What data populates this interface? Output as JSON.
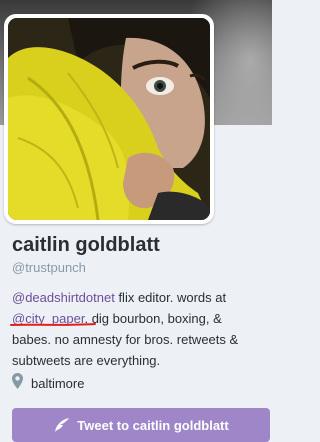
{
  "profile": {
    "display_name": "caitlin goldblatt",
    "handle": "@trustpunch",
    "bio": {
      "mention_1": "@deadshirtdotnet",
      "text_1": " flix editor. words at ",
      "mention_2": "@city_paper",
      "text_2": ". dig bourbon, boxing, & babes. no amnesty for bros. retweets & subtweets are everything."
    },
    "location": "baltimore"
  },
  "actions": {
    "tweet_to_label": "Tweet to caitlin goldblatt"
  },
  "icons": {
    "location": "map-pin-icon",
    "tweet": "quill-icon"
  },
  "colors": {
    "link": "#6b4f99",
    "button": "#9e86c8",
    "annotation_underline": "#e0211b"
  }
}
